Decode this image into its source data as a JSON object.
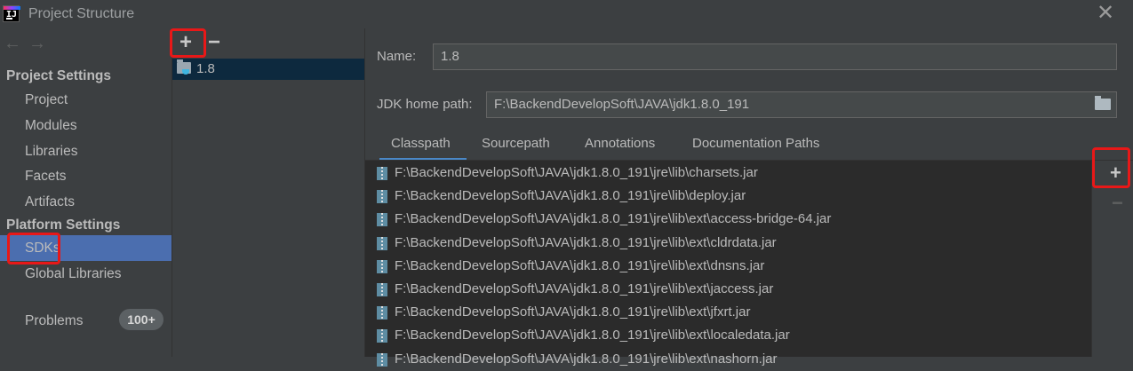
{
  "window": {
    "title": "Project Structure"
  },
  "left_nav": {
    "project_settings_header": "Project Settings",
    "project_settings_items": [
      "Project",
      "Modules",
      "Libraries",
      "Facets",
      "Artifacts"
    ],
    "platform_settings_header": "Platform Settings",
    "platform_settings_items": [
      "SDKs",
      "Global Libraries"
    ],
    "selected_item": "SDKs",
    "problems": {
      "label": "Problems",
      "badge": "100+"
    }
  },
  "sdk_list": {
    "add_label": "+",
    "remove_label": "−",
    "items": [
      "1.8"
    ]
  },
  "details": {
    "name_label": "Name:",
    "name_value": "1.8",
    "home_path_label": "JDK home path:",
    "home_path_value": "F:\\BackendDevelopSoft\\JAVA\\jdk1.8.0_191",
    "tabs": [
      "Classpath",
      "Sourcepath",
      "Annotations",
      "Documentation Paths"
    ],
    "active_tab": "Classpath",
    "classpath": [
      "F:\\BackendDevelopSoft\\JAVA\\jdk1.8.0_191\\jre\\lib\\charsets.jar",
      "F:\\BackendDevelopSoft\\JAVA\\jdk1.8.0_191\\jre\\lib\\deploy.jar",
      "F:\\BackendDevelopSoft\\JAVA\\jdk1.8.0_191\\jre\\lib\\ext\\access-bridge-64.jar",
      "F:\\BackendDevelopSoft\\JAVA\\jdk1.8.0_191\\jre\\lib\\ext\\cldrdata.jar",
      "F:\\BackendDevelopSoft\\JAVA\\jdk1.8.0_191\\jre\\lib\\ext\\dnsns.jar",
      "F:\\BackendDevelopSoft\\JAVA\\jdk1.8.0_191\\jre\\lib\\ext\\jaccess.jar",
      "F:\\BackendDevelopSoft\\JAVA\\jdk1.8.0_191\\jre\\lib\\ext\\jfxrt.jar",
      "F:\\BackendDevelopSoft\\JAVA\\jdk1.8.0_191\\jre\\lib\\ext\\localedata.jar",
      "F:\\BackendDevelopSoft\\JAVA\\jdk1.8.0_191\\jre\\lib\\ext\\nashorn.jar"
    ],
    "side_add_label": "+",
    "side_remove_label": "−"
  },
  "colors": {
    "accent_selection": "#4b6eaf",
    "highlight_annotation": "#e81818",
    "tab_underline": "#4a88c7"
  }
}
